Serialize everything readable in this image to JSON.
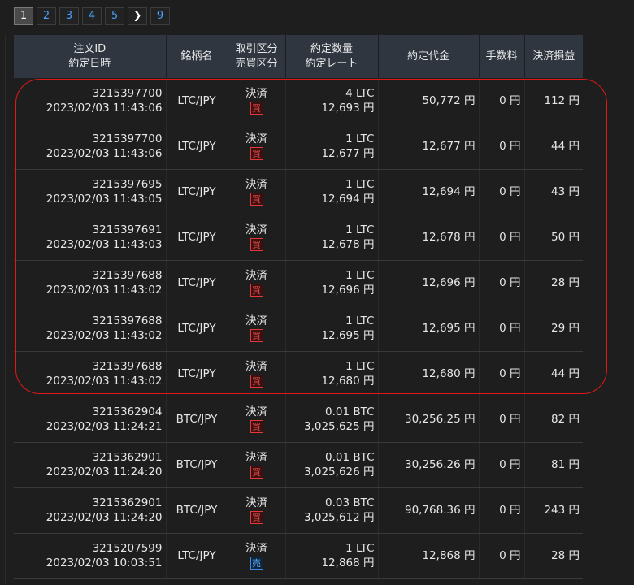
{
  "pagination": {
    "pages": [
      "1",
      "2",
      "3",
      "4",
      "5"
    ],
    "next_icon": "chevron-right-icon",
    "next_glyph": "❯",
    "last_page": "9"
  },
  "table": {
    "headers": [
      {
        "line1": "注文ID",
        "line2": "約定日時"
      },
      {
        "line1": "銘柄名",
        "line2": ""
      },
      {
        "line1": "取引区分",
        "line2": "売買区分"
      },
      {
        "line1": "約定数量",
        "line2": "約定レート"
      },
      {
        "line1": "約定代金",
        "line2": ""
      },
      {
        "line1": "手数料",
        "line2": ""
      },
      {
        "line1": "決済損益",
        "line2": ""
      }
    ],
    "rows": [
      {
        "order_id": "3215397700",
        "datetime": "2023/02/03 11:43:06",
        "symbol": "LTC/JPY",
        "trade_type": "決済",
        "side": "買",
        "quantity": "4 LTC",
        "rate": "12,693 円",
        "amount": "50,772 円",
        "fee": "0 円",
        "pnl": "112 円"
      },
      {
        "order_id": "3215397700",
        "datetime": "2023/02/03 11:43:06",
        "symbol": "LTC/JPY",
        "trade_type": "決済",
        "side": "買",
        "quantity": "1 LTC",
        "rate": "12,677 円",
        "amount": "12,677 円",
        "fee": "0 円",
        "pnl": "44 円"
      },
      {
        "order_id": "3215397695",
        "datetime": "2023/02/03 11:43:05",
        "symbol": "LTC/JPY",
        "trade_type": "決済",
        "side": "買",
        "quantity": "1 LTC",
        "rate": "12,694 円",
        "amount": "12,694 円",
        "fee": "0 円",
        "pnl": "43 円"
      },
      {
        "order_id": "3215397691",
        "datetime": "2023/02/03 11:43:03",
        "symbol": "LTC/JPY",
        "trade_type": "決済",
        "side": "買",
        "quantity": "1 LTC",
        "rate": "12,678 円",
        "amount": "12,678 円",
        "fee": "0 円",
        "pnl": "50 円"
      },
      {
        "order_id": "3215397688",
        "datetime": "2023/02/03 11:43:02",
        "symbol": "LTC/JPY",
        "trade_type": "決済",
        "side": "買",
        "quantity": "1 LTC",
        "rate": "12,696 円",
        "amount": "12,696 円",
        "fee": "0 円",
        "pnl": "28 円"
      },
      {
        "order_id": "3215397688",
        "datetime": "2023/02/03 11:43:02",
        "symbol": "LTC/JPY",
        "trade_type": "決済",
        "side": "買",
        "quantity": "1 LTC",
        "rate": "12,695 円",
        "amount": "12,695 円",
        "fee": "0 円",
        "pnl": "29 円"
      },
      {
        "order_id": "3215397688",
        "datetime": "2023/02/03 11:43:02",
        "symbol": "LTC/JPY",
        "trade_type": "決済",
        "side": "買",
        "quantity": "1 LTC",
        "rate": "12,680 円",
        "amount": "12,680 円",
        "fee": "0 円",
        "pnl": "44 円"
      },
      {
        "order_id": "3215362904",
        "datetime": "2023/02/03 11:24:21",
        "symbol": "BTC/JPY",
        "trade_type": "決済",
        "side": "買",
        "quantity": "0.01 BTC",
        "rate": "3,025,625 円",
        "amount": "30,256.25 円",
        "fee": "0 円",
        "pnl": "82 円"
      },
      {
        "order_id": "3215362901",
        "datetime": "2023/02/03 11:24:20",
        "symbol": "BTC/JPY",
        "trade_type": "決済",
        "side": "買",
        "quantity": "0.01 BTC",
        "rate": "3,025,626 円",
        "amount": "30,256.26 円",
        "fee": "0 円",
        "pnl": "81 円"
      },
      {
        "order_id": "3215362901",
        "datetime": "2023/02/03 11:24:20",
        "symbol": "BTC/JPY",
        "trade_type": "決済",
        "side": "買",
        "quantity": "0.03 BTC",
        "rate": "3,025,612 円",
        "amount": "90,768.36 円",
        "fee": "0 円",
        "pnl": "243 円"
      },
      {
        "order_id": "3215207599",
        "datetime": "2023/02/03 10:03:51",
        "symbol": "LTC/JPY",
        "trade_type": "決済",
        "side": "売",
        "quantity": "1 LTC",
        "rate": "12,868 円",
        "amount": "12,868 円",
        "fee": "0 円",
        "pnl": "28 円"
      }
    ]
  },
  "colors": {
    "buy": "#e84a4a",
    "sell": "#5aa8ff",
    "highlight": "#e01818",
    "header_bg": "#2f3640"
  }
}
